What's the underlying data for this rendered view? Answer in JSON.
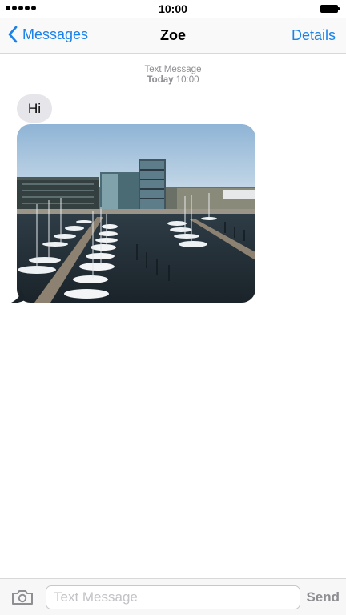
{
  "status_bar": {
    "time": "10:00",
    "signal_icon": "signal-dots-icon",
    "battery_icon": "battery-icon"
  },
  "nav": {
    "back_label": "Messages",
    "back_icon": "chevron-left-icon",
    "title": "Zoe",
    "details_label": "Details"
  },
  "thread": {
    "meta_type": "Text Message",
    "meta_day": "Today",
    "meta_time": "10:00",
    "messages": [
      {
        "direction": "incoming",
        "kind": "text",
        "text": "Hi"
      },
      {
        "direction": "incoming",
        "kind": "image",
        "subject": "harbor-marina-photo"
      }
    ]
  },
  "input_bar": {
    "camera_icon": "camera-icon",
    "placeholder": "Text Message",
    "value": "",
    "send_label": "Send"
  },
  "colors": {
    "accent": "#1a82e8",
    "incoming_bubble": "#e5e5ea",
    "meta_text": "#8e8e93",
    "send_disabled": "#8e8e93"
  }
}
